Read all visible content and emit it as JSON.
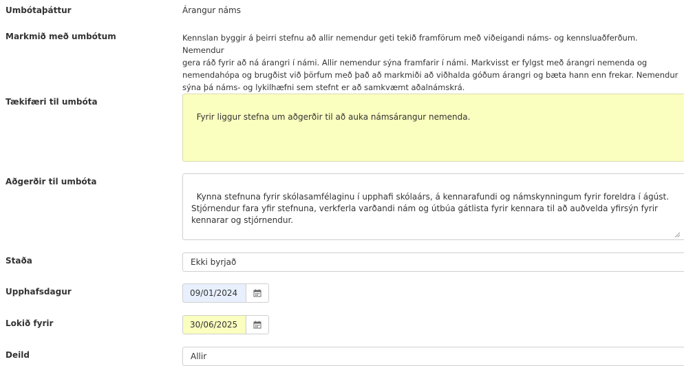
{
  "fields": {
    "umbotathattur": {
      "label": "Umbótaþáttur",
      "value": "Árangur náms"
    },
    "markmid": {
      "label": "Markmið með umbótum",
      "lines": [
        "Kennslan byggir á þeirri stefnu að allir nemendur geti tekið framförum með viðeigandi náms- og kennsluaðferðum. Nemendur",
        "gera ráð fyrir að ná árangri í námi. Allir nemendur sýna framfarir í námi. Markvisst er fylgst með árangri nemenda og",
        "nemendahópa og brugðist við þörfum með það að markmiði að viðhalda góðum árangri og bæta hann enn frekar. Nemendur",
        "sýna þá náms- og lykilhæfni sem stefnt er að samkvæmt aðalnámskrá."
      ]
    },
    "taekifaeri": {
      "label": "Tækifæri til umbóta",
      "value": "Fyrir liggur stefna um aðgerðir til að auka námsárangur nemenda."
    },
    "adgerdir": {
      "label": "Aðgerðir til umbóta",
      "value": "Kynna stefnuna fyrir skólasamfélaginu í upphafi skólaárs, á kennarafundi og námskynningum fyrir foreldra í ágúst.\nStjórnendur fara yfir stefnuna, verkferla varðandi nám og útbúa gátlista fyrir kennara til að auðvelda yfirsýn fyrir\nkennarar og stjórnendur."
    },
    "stada": {
      "label": "Staða",
      "selected": "Ekki byrjað"
    },
    "upphafsdagur": {
      "label": "Upphafsdagur",
      "value": "09/01/2024"
    },
    "lokid": {
      "label": "Lokið fyrir",
      "value": "30/06/2025"
    },
    "deild": {
      "label": "Deild",
      "selected": "Allir"
    }
  },
  "icons": {
    "calendar": "calendar-icon",
    "caret": "chevron-down-icon",
    "resize": "resize-handle-icon"
  },
  "colors": {
    "highlight_yellow": "#fafebe",
    "autofill_blue": "#e8f0fe"
  }
}
